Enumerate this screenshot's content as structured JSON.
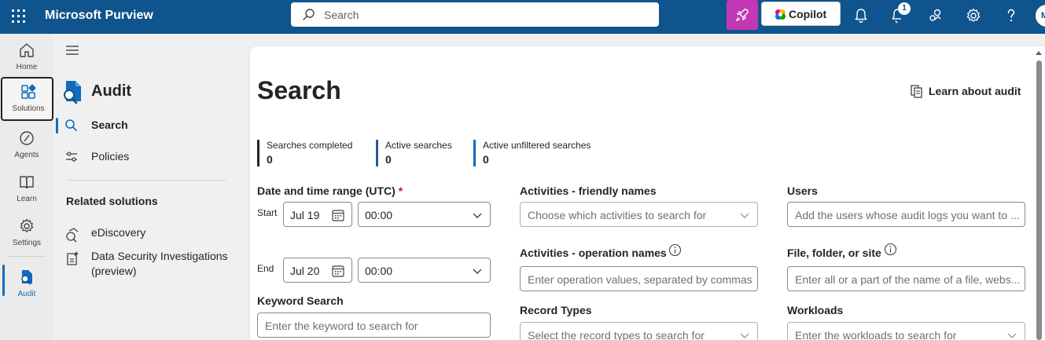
{
  "header": {
    "app_title": "Microsoft Purview",
    "search_placeholder": "Search",
    "copilot_label": "Copilot",
    "notification_count": "1",
    "avatar_initial": "M",
    "colors": {
      "bar": "#0f548c",
      "rocket": "#c239b3"
    }
  },
  "rail": {
    "items": [
      {
        "label": "Home",
        "icon": "home-icon"
      },
      {
        "label": "Solutions",
        "icon": "solutions-icon"
      },
      {
        "label": "Agents",
        "icon": "agents-icon"
      },
      {
        "label": "Learn",
        "icon": "book-icon"
      },
      {
        "label": "Settings",
        "icon": "gear-icon"
      },
      {
        "label": "Audit",
        "icon": "audit-icon"
      }
    ]
  },
  "nav": {
    "title": "Audit",
    "items": [
      {
        "label": "Search",
        "icon": "search-icon",
        "selected": true
      },
      {
        "label": "Policies",
        "icon": "policies-icon"
      }
    ],
    "related_heading": "Related solutions",
    "related": [
      {
        "label": "eDiscovery",
        "icon": "ediscovery-icon"
      },
      {
        "label": "Data Security Investigations (preview)",
        "icon": "sparkle-doc-icon"
      }
    ]
  },
  "main": {
    "title": "Search",
    "learn_link": "Learn about audit",
    "stats": [
      {
        "label": "Searches completed",
        "value": "0",
        "color": "#242424"
      },
      {
        "label": "Active searches",
        "value": "0",
        "color": "#2b5a8a"
      },
      {
        "label": "Active unfiltered searches",
        "value": "0",
        "color": "#0f6cbd"
      }
    ],
    "date_range": {
      "label": "Date and time range (UTC)",
      "required_mark": "*",
      "start_label": "Start",
      "start_date": "Jul 19",
      "start_time": "00:00",
      "end_label": "End",
      "end_date": "Jul 20",
      "end_time": "00:00"
    },
    "keyword": {
      "label": "Keyword Search",
      "placeholder": "Enter the keyword to search for"
    },
    "activities_friendly": {
      "label": "Activities - friendly names",
      "placeholder": "Choose which activities to search for"
    },
    "activities_operation": {
      "label": "Activities - operation names",
      "placeholder": "Enter operation values, separated by commas"
    },
    "record_types": {
      "label": "Record Types",
      "placeholder": "Select the record types to search for"
    },
    "users": {
      "label": "Users",
      "placeholder": "Add the users whose audit logs you want to ..."
    },
    "file_folder": {
      "label": "File, folder, or site",
      "placeholder": "Enter all or a part of the name of a file, webs..."
    },
    "workloads": {
      "label": "Workloads",
      "placeholder": "Enter the workloads to search for"
    }
  }
}
